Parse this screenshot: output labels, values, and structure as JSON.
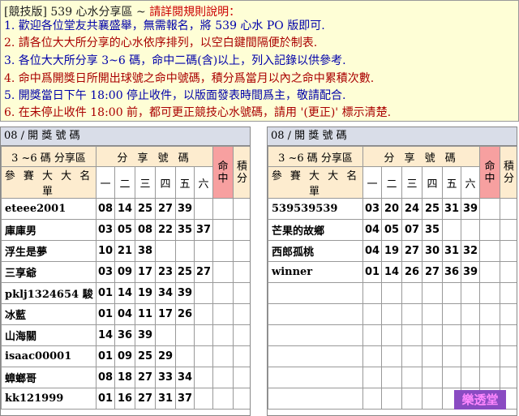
{
  "notice": {
    "title_prefix": "[競技版]  539 心水分享區  ~ ",
    "title_alert": "請詳閱規則說明：",
    "rules": [
      {
        "text": "1. 歡迎各位堂友共襄盛舉，無需報名，將 539 心水 PO 版即可.",
        "color": "#0000aa"
      },
      {
        "text": "2. 請各位大大所分享的心水依序排列，以空白鍵間隔便於制表.",
        "color": "#aa0000"
      },
      {
        "text": "3. 各位大大所分享 3~6 碼，命中二碼(含)以上，列入記錄以供參考.",
        "color": "#0000aa"
      },
      {
        "text": "4. 命中爲開獎日所開出球號之命中號碼，積分爲當月以內之命中累積次數.",
        "color": "#aa0000"
      },
      {
        "text": "5. 開獎當日下午 18:00 停止收件，以版面發表時間爲主，敬請配合.",
        "color": "#0000aa"
      },
      {
        "text": "6. 在未停止收件 18:00 前，都可更正競技心水號碼，請用 '(更正)' 標示清楚.",
        "color": "#aa0000"
      }
    ]
  },
  "panels": [
    {
      "header": "08 /  開 獎 號 碼",
      "category_label": "3 ~6 碼 分享區",
      "share_label": "分 享 號 碼",
      "hit_label": "命中",
      "score_label": "積分",
      "name_header": "參 賽 大 大 名 單",
      "days": [
        "一",
        "二",
        "三",
        "四",
        "五",
        "六"
      ],
      "rows": [
        {
          "name": "eteee2001",
          "nums": [
            "08",
            "14",
            "25",
            "27",
            "39",
            ""
          ]
        },
        {
          "name": "庫庫男",
          "nums": [
            "03",
            "05",
            "08",
            "22",
            "35",
            "37"
          ]
        },
        {
          "name": "浮生是夢",
          "nums": [
            "10",
            "21",
            "38",
            "",
            "",
            ""
          ]
        },
        {
          "name": "三享爺",
          "nums": [
            "03",
            "09",
            "17",
            "23",
            "25",
            "27"
          ]
        },
        {
          "name": "pklj1324654 駿",
          "nums": [
            "01",
            "14",
            "19",
            "34",
            "39",
            ""
          ]
        },
        {
          "name": "冰藍",
          "nums": [
            "01",
            "04",
            "11",
            "17",
            "26",
            ""
          ]
        },
        {
          "name": "山海關",
          "nums": [
            "14",
            "36",
            "39",
            "",
            "",
            ""
          ]
        },
        {
          "name": "isaac00001",
          "nums": [
            "01",
            "09",
            "25",
            "29",
            "",
            ""
          ]
        },
        {
          "name": "蟑螂哥",
          "nums": [
            "08",
            "18",
            "27",
            "33",
            "34",
            ""
          ]
        },
        {
          "name": "kk121999",
          "nums": [
            "01",
            "16",
            "27",
            "31",
            "37",
            ""
          ]
        }
      ]
    },
    {
      "header": "08 /  開 獎 號 碼",
      "category_label": "3 ~6 碼 分享區",
      "share_label": "分 享 號 碼",
      "hit_label": "命中",
      "score_label": "積分",
      "name_header": "參 賽 大 大 名 單",
      "days": [
        "一",
        "二",
        "三",
        "四",
        "五",
        "六"
      ],
      "rows": [
        {
          "name": "539539539",
          "nums": [
            "03",
            "20",
            "24",
            "25",
            "31",
            "39"
          ]
        },
        {
          "name": "芒果的故鄉",
          "nums": [
            "04",
            "05",
            "07",
            "35",
            "",
            ""
          ]
        },
        {
          "name": "西郎孤桃",
          "nums": [
            "04",
            "19",
            "27",
            "30",
            "31",
            "32"
          ]
        },
        {
          "name": "winner",
          "nums": [
            "01",
            "14",
            "26",
            "27",
            "36",
            "39"
          ]
        },
        {
          "name": "",
          "nums": [
            "",
            "",
            "",
            "",
            "",
            ""
          ]
        },
        {
          "name": "",
          "nums": [
            "",
            "",
            "",
            "",
            "",
            ""
          ]
        },
        {
          "name": "",
          "nums": [
            "",
            "",
            "",
            "",
            "",
            ""
          ]
        },
        {
          "name": "",
          "nums": [
            "",
            "",
            "",
            "",
            "",
            ""
          ]
        },
        {
          "name": "",
          "nums": [
            "",
            "",
            "",
            "",
            "",
            ""
          ]
        },
        {
          "name": "",
          "nums": [
            "",
            "",
            "",
            "",
            "",
            ""
          ]
        }
      ]
    }
  ],
  "hall_label": "樂透堂"
}
